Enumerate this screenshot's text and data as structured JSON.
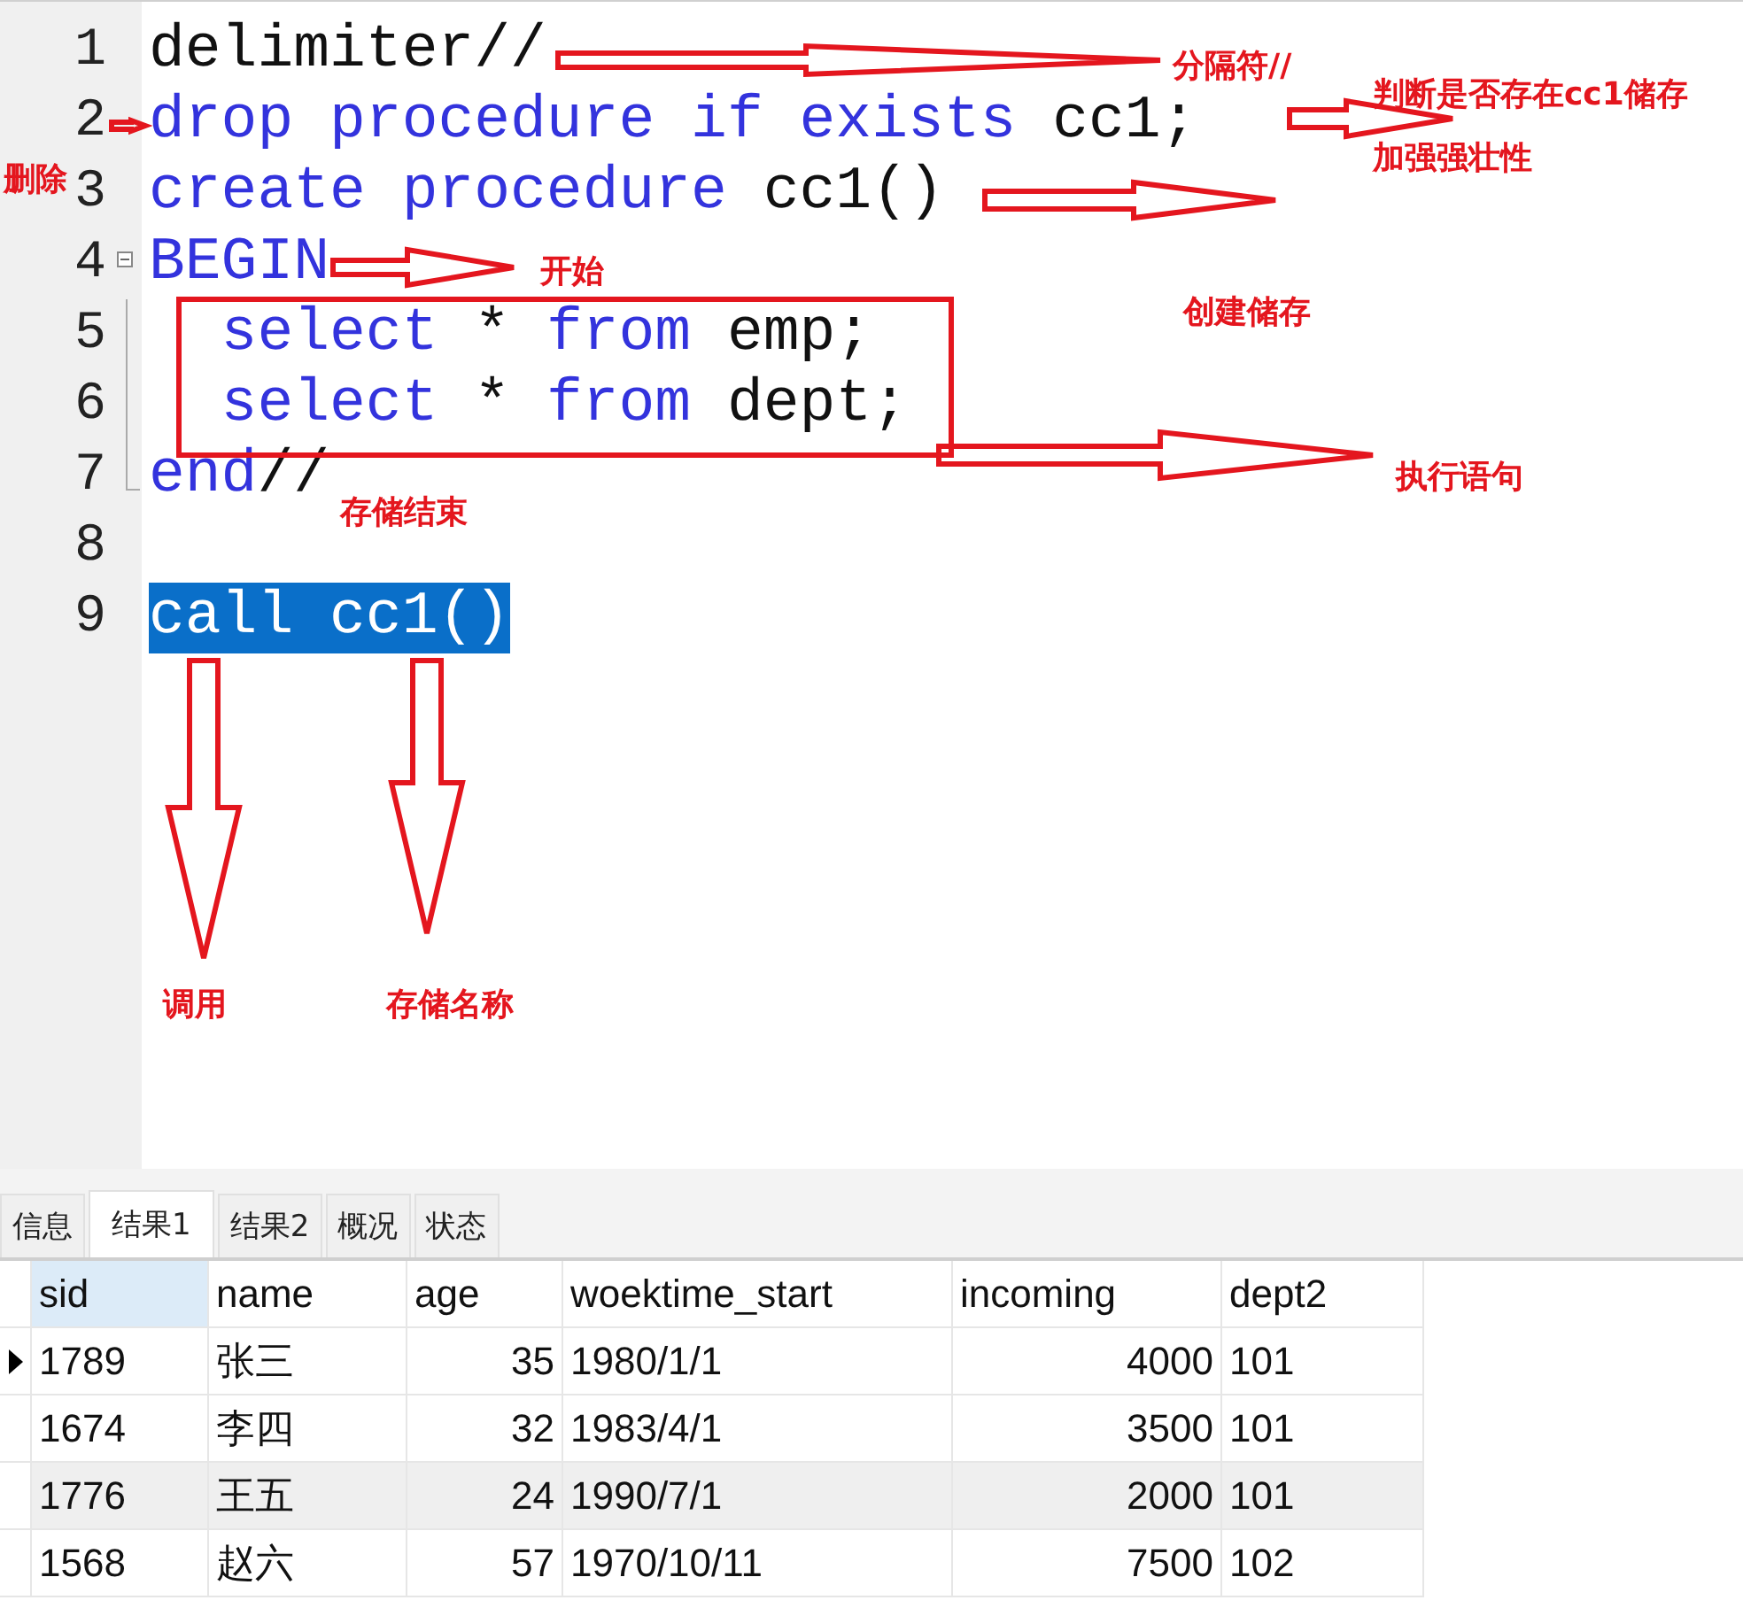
{
  "editor": {
    "lines": [
      {
        "number": "1",
        "selected": false,
        "tokens": [
          {
            "text": "delimiter//",
            "kind": "plain"
          }
        ]
      },
      {
        "number": "2",
        "selected": false,
        "tokens": [
          {
            "text": "drop procedure if exists",
            "kind": "keyword"
          },
          {
            "text": " cc1;",
            "kind": "plain"
          }
        ]
      },
      {
        "number": "3",
        "selected": false,
        "tokens": [
          {
            "text": "create procedure",
            "kind": "keyword"
          },
          {
            "text": " cc1()",
            "kind": "plain"
          }
        ]
      },
      {
        "number": "4",
        "selected": false,
        "expanded": true,
        "tokens": [
          {
            "text": "BEGIN",
            "kind": "keyword"
          }
        ],
        "children": [
          {
            "number": "5",
            "selected": false,
            "tokens": [
              {
                "text": "  select",
                "kind": "keyword"
              },
              {
                "text": " * ",
                "kind": "plain"
              },
              {
                "text": "from",
                "kind": "keyword"
              },
              {
                "text": " emp;",
                "kind": "plain"
              }
            ]
          },
          {
            "number": "6",
            "selected": false,
            "tokens": [
              {
                "text": "  select",
                "kind": "keyword"
              },
              {
                "text": " * ",
                "kind": "plain"
              },
              {
                "text": "from",
                "kind": "keyword"
              },
              {
                "text": " dept;",
                "kind": "plain"
              }
            ]
          }
        ]
      },
      {
        "number": "7",
        "selected": false,
        "tokens": [
          {
            "text": "end",
            "kind": "keyword"
          },
          {
            "text": "//",
            "kind": "plain"
          }
        ]
      },
      {
        "number": "8",
        "selected": false
      },
      {
        "number": "9",
        "selected": true,
        "tokens": [
          {
            "text": "call cc1()",
            "kind": "plain"
          }
        ]
      }
    ]
  },
  "annotations": [
    "分隔符//",
    "判断是否存在cc1储存",
    "加强强壮性",
    "删除",
    "开始",
    "创建储存",
    "执行语句",
    "存储结束",
    "调用",
    "存储名称"
  ],
  "result_tabs": [
    {
      "label": "信息",
      "selected": false
    },
    {
      "label": "结果1",
      "selected": true
    },
    {
      "label": "结果2",
      "selected": false
    },
    {
      "label": "概况",
      "selected": false
    },
    {
      "label": "状态",
      "selected": false
    }
  ],
  "table": {
    "columns": [
      {
        "label": "sid",
        "kind": "text",
        "selected": true
      },
      {
        "label": "name",
        "kind": "text",
        "selected": false
      },
      {
        "label": "age",
        "kind": "number",
        "selected": false
      },
      {
        "label": "woektime_start",
        "kind": "text",
        "selected": false
      },
      {
        "label": "incoming",
        "kind": "number",
        "selected": false
      },
      {
        "label": "dept2",
        "kind": "text",
        "selected": false
      }
    ],
    "rows": [
      {
        "current": true,
        "highlighted": false,
        "cells": [
          "1789",
          "张三",
          "35",
          "1980/1/1",
          "4000",
          "101"
        ]
      },
      {
        "current": false,
        "highlighted": false,
        "cells": [
          "1674",
          "李四",
          "32",
          "1983/4/1",
          "3500",
          "101"
        ]
      },
      {
        "current": false,
        "highlighted": true,
        "cells": [
          "1776",
          "王五",
          "24",
          "1990/7/1",
          "2000",
          "101"
        ]
      },
      {
        "current": false,
        "highlighted": false,
        "cells": [
          "1568",
          "赵六",
          "57",
          "1970/10/11",
          "7500",
          "102"
        ]
      }
    ]
  }
}
